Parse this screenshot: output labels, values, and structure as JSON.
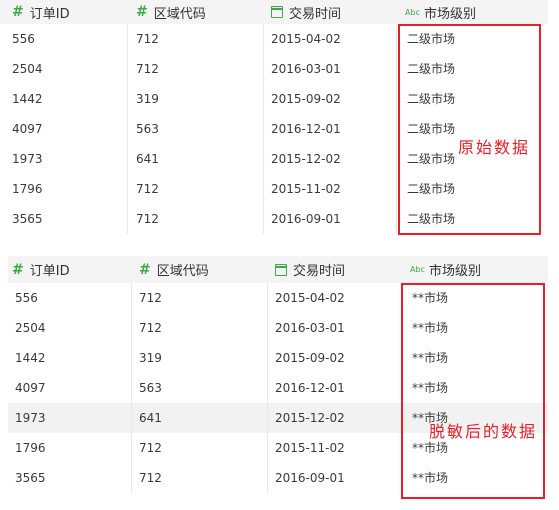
{
  "original_table": {
    "columns": [
      {
        "label": "订单ID",
        "icon": "number-icon"
      },
      {
        "label": "区域代码",
        "icon": "number-icon"
      },
      {
        "label": "交易时间",
        "icon": "calendar-icon"
      },
      {
        "label": "市场级别",
        "icon": "text-abc-icon"
      }
    ],
    "type_badge": "Abc",
    "hash_symbol": "#",
    "rows": [
      [
        "556",
        "712",
        "2015-04-02",
        "二级市场"
      ],
      [
        "2504",
        "712",
        "2016-03-01",
        "二级市场"
      ],
      [
        "1442",
        "319",
        "2015-09-02",
        "二级市场"
      ],
      [
        "4097",
        "563",
        "2016-12-01",
        "二级市场"
      ],
      [
        "1973",
        "641",
        "2015-12-02",
        "二级市场"
      ],
      [
        "1796",
        "712",
        "2015-11-02",
        "二级市场"
      ],
      [
        "3565",
        "712",
        "2016-09-01",
        "二级市场"
      ]
    ],
    "annotation": "原始数据"
  },
  "masked_table": {
    "columns": [
      {
        "label": "订单ID",
        "icon": "number-icon"
      },
      {
        "label": "区域代码",
        "icon": "number-icon"
      },
      {
        "label": "交易时间",
        "icon": "calendar-icon"
      },
      {
        "label": "市场级别",
        "icon": "text-abc-icon"
      }
    ],
    "type_badge": "Abc",
    "hash_symbol": "#",
    "rows": [
      [
        "556",
        "712",
        "2015-04-02",
        "**市场"
      ],
      [
        "2504",
        "712",
        "2016-03-01",
        "**市场"
      ],
      [
        "1442",
        "319",
        "2015-09-02",
        "**市场"
      ],
      [
        "4097",
        "563",
        "2016-12-01",
        "**市场"
      ],
      [
        "1973",
        "641",
        "2015-12-02",
        "**市场"
      ],
      [
        "1796",
        "712",
        "2015-11-02",
        "**市场"
      ],
      [
        "3565",
        "712",
        "2016-09-01",
        "**市场"
      ]
    ],
    "highlighted_row_index": 4,
    "annotation": "脱敏后的数据"
  },
  "colors": {
    "type_icon": "#3fa94a",
    "annotation": "#e5202a",
    "header_bg": "#f4f4f4",
    "highlight_row": "#f2f2f2"
  }
}
